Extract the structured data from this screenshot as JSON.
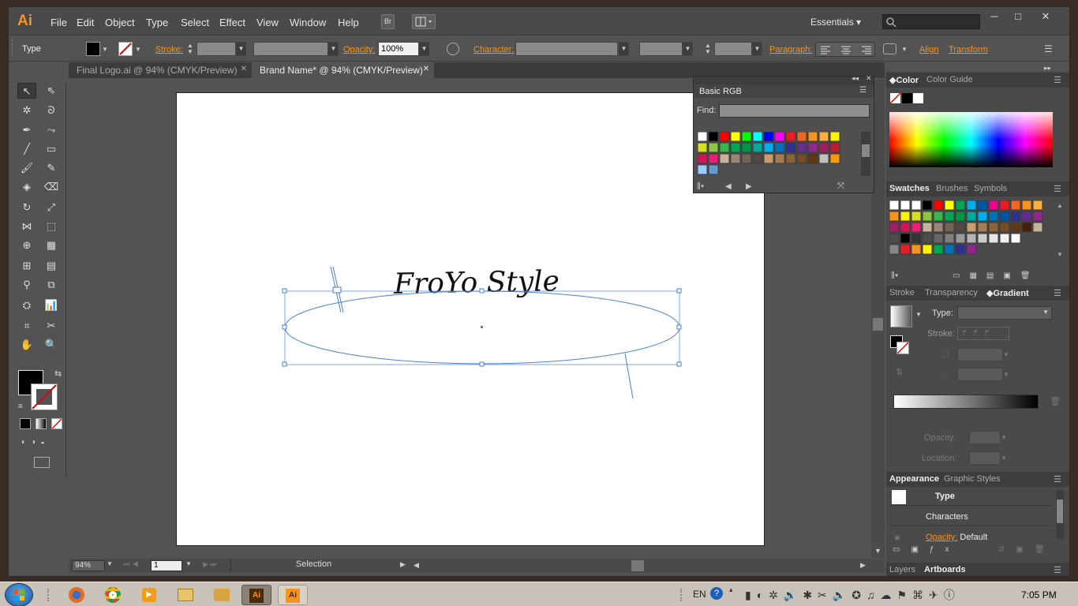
{
  "app": {
    "logo": "Ai"
  },
  "menu": [
    "File",
    "Edit",
    "Object",
    "Type",
    "Select",
    "Effect",
    "View",
    "Window",
    "Help"
  ],
  "toolbar_buttons": {
    "bridge": "Br"
  },
  "workspace": "Essentials",
  "window_controls": {
    "minimize": "─",
    "maximize": "□",
    "close": "✕"
  },
  "control": {
    "mode": "Type",
    "stroke_label": "Stroke:",
    "opacity_label": "Opacity:",
    "opacity_value": "100%",
    "character_label": "Character:",
    "paragraph_label": "Paragraph:",
    "align_label": "Align",
    "transform_label": "Transform"
  },
  "tabs": [
    {
      "label": "Final Logo.ai @ 94% (CMYK/Preview)",
      "close": "✕"
    },
    {
      "label": "Brand Name* @ 94% (CMYK/Preview)",
      "close": "✕"
    }
  ],
  "artwork": {
    "text": "FroYo Style"
  },
  "status": {
    "zoom": "94%",
    "page": "1",
    "tool": "Selection"
  },
  "rgb_panel": {
    "title": "Basic RGB",
    "find_label": "Find:"
  },
  "color_panel": {
    "tabs": [
      "Color",
      "Color Guide"
    ]
  },
  "swatches_panel": {
    "tabs": [
      "Swatches",
      "Brushes",
      "Symbols"
    ]
  },
  "gradient_panel": {
    "tabs": [
      "Stroke",
      "Transparency",
      "Gradient"
    ],
    "type_label": "Type:",
    "stroke_label": "Stroke:",
    "opacity_label": "Opacity:",
    "location_label": "Location:"
  },
  "appearance_panel": {
    "tabs": [
      "Appearance",
      "Graphic Styles"
    ],
    "rows": [
      "Type",
      "Characters"
    ],
    "opacity_label": "Opacity:",
    "opacity_value": "Default"
  },
  "layers_panel": {
    "tabs": [
      "Layers",
      "Artboards"
    ]
  },
  "taskbar": {
    "language": "EN",
    "clock": "7:05 PM"
  },
  "colors": {
    "accent": "#f7931e",
    "selection": "#4a7fd6"
  }
}
